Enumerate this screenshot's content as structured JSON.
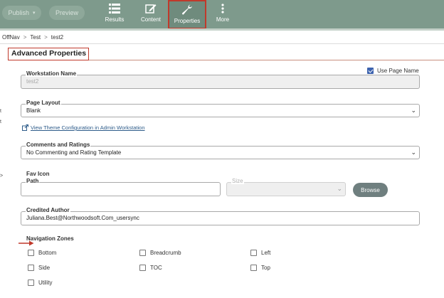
{
  "toolbar": {
    "publish_label": "Publish",
    "publish_caret": "▾",
    "preview_label": "Preview",
    "items": [
      {
        "label": "Results",
        "icon": "list-icon"
      },
      {
        "label": "Content",
        "icon": "edit-icon"
      },
      {
        "label": "Properties",
        "icon": "wrench-icon",
        "active": true
      },
      {
        "label": "More",
        "icon": "more-vertical-icon"
      }
    ]
  },
  "breadcrumb": {
    "items": [
      "OffNav",
      "Test",
      "test2"
    ],
    "separator": ">"
  },
  "section": {
    "title": "Advanced Properties"
  },
  "edge_marks": {
    "m1": "t",
    "m2": "t",
    "m3": ">"
  },
  "form": {
    "use_page_name": {
      "label": "Use Page Name",
      "checked": true
    },
    "workstation_name": {
      "label": "Workstation Name",
      "value": "test2",
      "disabled": true
    },
    "page_layout": {
      "label": "Page Layout",
      "value": "Blank"
    },
    "theme_link": {
      "label": "View Theme Configuration in Admin Workstation",
      "icon": "external-link-icon"
    },
    "comments_ratings": {
      "label": "Comments and Ratings",
      "value": "No Commenting and Rating Template"
    },
    "fav_icon": {
      "label": "Fav Icon",
      "path_label": "Path",
      "path_value": "",
      "size_label": "Size",
      "size_value": "",
      "browse_label": "Browse"
    },
    "credited_author": {
      "label": "Credited Author",
      "value": "Juliana.Best@Northwoodsoft.Com_usersync"
    },
    "navigation_zones": {
      "label": "Navigation Zones",
      "options": [
        {
          "label": "Bottom",
          "checked": false
        },
        {
          "label": "Breadcrumb",
          "checked": false
        },
        {
          "label": "Left",
          "checked": false
        },
        {
          "label": "Side",
          "checked": false
        },
        {
          "label": "TOC",
          "checked": false
        },
        {
          "label": "Top",
          "checked": false
        },
        {
          "label": "Utility",
          "checked": false
        }
      ]
    }
  },
  "colors": {
    "toolbar_bg": "#7e9a8c",
    "highlight_border": "#c0392b",
    "checkbox_checked": "#3d63ae",
    "link": "#2e5c8a",
    "browse_bg": "#6f7f7f"
  }
}
